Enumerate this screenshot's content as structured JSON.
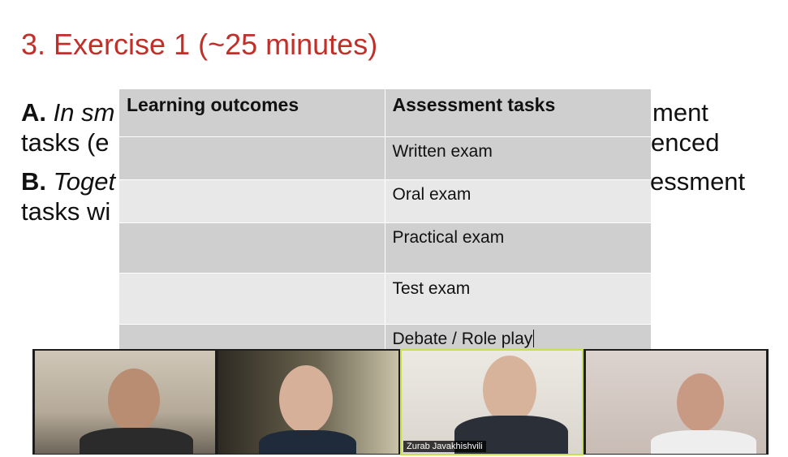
{
  "slide": {
    "title": "3. Exercise 1 (~25 minutes)",
    "lines": {
      "a_label": "A.",
      "a_text_visible": "In sm",
      "a_text_right": "ment",
      "a2_left": "tasks (e",
      "a2_right": "enced",
      "b_label": "B.",
      "b_text_visible": "Toget",
      "b_text_right": "essment",
      "b2_left": "tasks wi"
    },
    "title_color": "#c0302b"
  },
  "table": {
    "headers": [
      "Learning outcomes",
      "Assessment tasks"
    ],
    "rows": [
      {
        "outcome": "",
        "task": "Written exam"
      },
      {
        "outcome": "",
        "task": "Oral exam"
      },
      {
        "outcome": "",
        "task": "Practical exam"
      },
      {
        "outcome": "",
        "task": "Test exam"
      },
      {
        "outcome": "",
        "task": "Debate / Role play"
      }
    ]
  },
  "video": {
    "participants": [
      {
        "name": "",
        "active": false
      },
      {
        "name": "",
        "active": false
      },
      {
        "name": "Zurab Javakhishvili",
        "active": true
      },
      {
        "name": "",
        "active": false
      }
    ],
    "active_border_color": "#c7e14a"
  }
}
